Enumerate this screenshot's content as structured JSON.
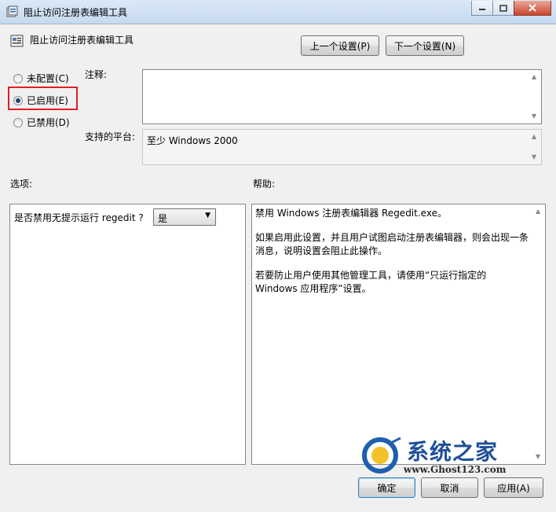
{
  "window": {
    "title": "阻止访问注册表编辑工具"
  },
  "header": {
    "setting_name": "阻止访问注册表编辑工具",
    "prev_button": "上一个设置(P)",
    "next_button": "下一个设置(N)"
  },
  "state_options": [
    {
      "label": "未配置(C)",
      "checked": false
    },
    {
      "label": "已启用(E)",
      "checked": true
    },
    {
      "label": "已禁用(D)",
      "checked": false
    }
  ],
  "comment": {
    "label": "注释:",
    "value": ""
  },
  "platform": {
    "label": "支持的平台:",
    "value": "至少 Windows 2000"
  },
  "options": {
    "label": "选项:",
    "question": "是否禁用无提示运行 regedit ?",
    "select_value": "是"
  },
  "help": {
    "label": "帮助:",
    "paragraphs": [
      "禁用 Windows 注册表编辑器 Regedit.exe。",
      "如果启用此设置，并且用户试图启动注册表编辑器，则会出现一条消息，说明设置会阻止此操作。",
      "若要防止用户使用其他管理工具，请使用“只运行指定的 Windows 应用程序”设置。"
    ]
  },
  "footer": {
    "ok": "确定",
    "cancel": "取消",
    "apply": "应用(A)"
  },
  "watermark": {
    "brand": "系统之家",
    "url": "www.Ghost123.com"
  },
  "colors": {
    "highlight_box": "#e02020"
  }
}
